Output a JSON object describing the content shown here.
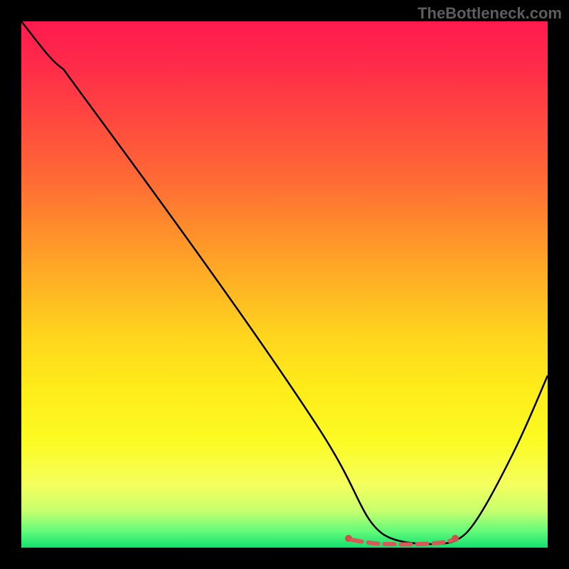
{
  "watermark": "TheBottleneck.com",
  "colors": {
    "page_bg": "#000000",
    "watermark": "#5d5d5d",
    "curve": "#000000",
    "marker_line": "#d75a5a",
    "marker_dot": "#d44d4d",
    "gradient_stops": [
      "#ff1a4e",
      "#ff2a4a",
      "#ff4640",
      "#ff6a35",
      "#ff8f2b",
      "#ffb324",
      "#ffd61e",
      "#ffec1a",
      "#fbfb24",
      "#f5ff5e",
      "#c7ff6e",
      "#60fa7a",
      "#13e06e"
    ]
  },
  "chart_data": {
    "type": "line",
    "title": "",
    "xlabel": "",
    "ylabel": "",
    "xlim": [
      0,
      100
    ],
    "ylim": [
      0,
      100
    ],
    "note": "x and y are in percent of the inner plot box; y=100 is top, y=0 is bottom. Values read from pixel positions.",
    "series": [
      {
        "name": "bottleneck-curve",
        "x": [
          0,
          3,
          8,
          15,
          25,
          35,
          45,
          55,
          60,
          62,
          65,
          70,
          75,
          80,
          82,
          85,
          90,
          95,
          100
        ],
        "y": [
          100,
          97,
          91,
          82,
          68,
          54,
          40,
          25,
          16,
          12,
          7,
          3,
          1,
          1,
          2,
          5,
          14,
          27,
          41
        ]
      }
    ],
    "annotations": {
      "flat_zone": {
        "description": "highlighted near-minimum segment (red dashed with end dots)",
        "x_start": 62,
        "x_end": 82,
        "y": 1.8
      }
    }
  }
}
